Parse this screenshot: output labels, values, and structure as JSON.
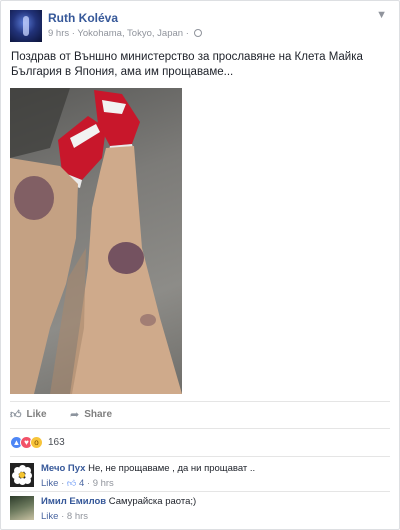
{
  "post": {
    "author": "Ruth Koléva",
    "time": "9 hrs",
    "location": "Yokohama, Tokyo, Japan",
    "text": "Поздрав от Външно министерство за прославяне на Клета Майка България в Япония, ама им прощаваме..."
  },
  "actions": {
    "like_label": "Like",
    "share_label": "Share"
  },
  "reactions": {
    "count": "163"
  },
  "comments": [
    {
      "author": "Мечо Пух",
      "text": "Не, не прощаваме , да ни прощават ..",
      "like_label": "Like",
      "likes": "4",
      "time": "9 hrs"
    },
    {
      "author": "Имил Емилов",
      "text": "Самурайска раота;)",
      "like_label": "Like",
      "time": "8 hrs"
    }
  ]
}
